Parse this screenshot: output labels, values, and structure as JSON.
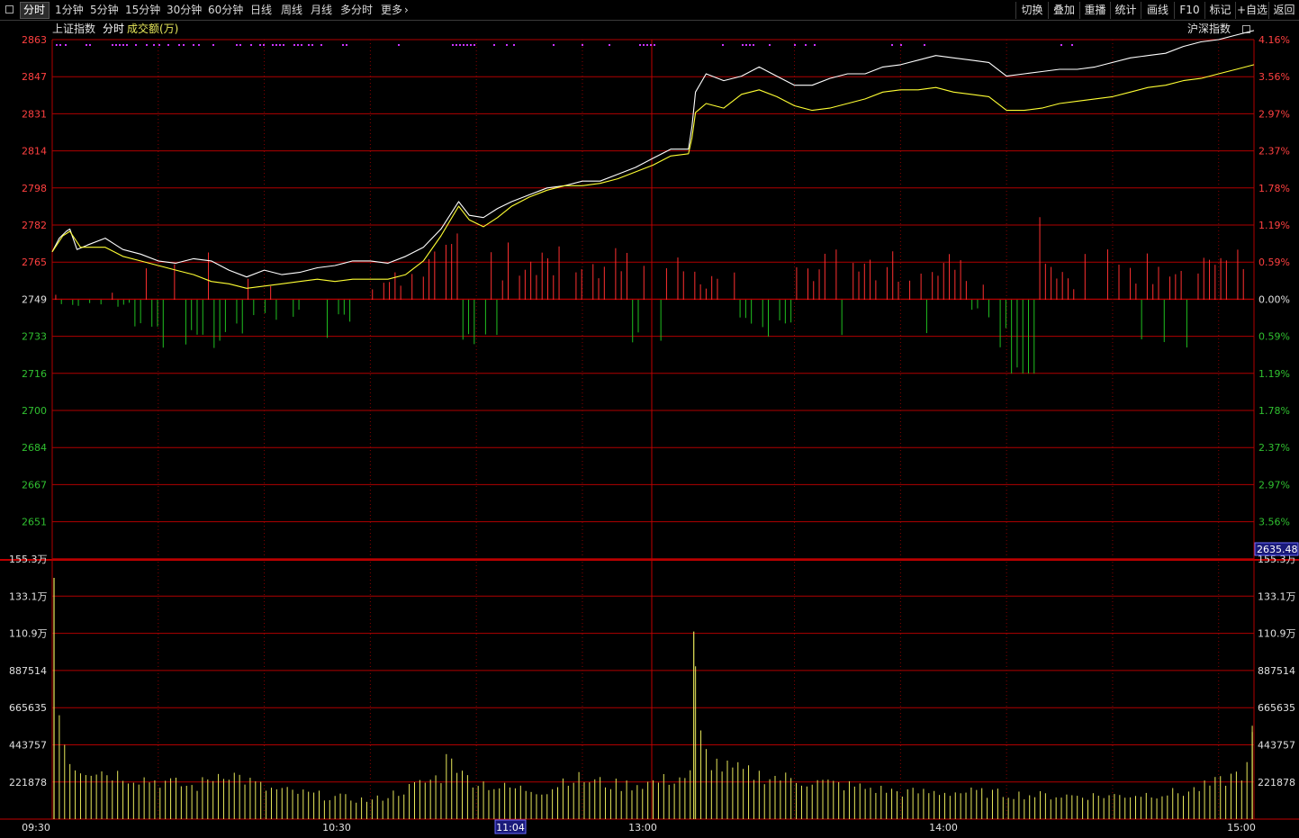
{
  "toolbar": {
    "periods": [
      "分时",
      "1分钟",
      "5分钟",
      "15分钟",
      "30分钟",
      "60分钟",
      "日线",
      "周线",
      "月线",
      "多分时",
      "更多"
    ],
    "active_period": "分时",
    "buttons": [
      "切换",
      "叠加",
      "重播",
      "统计",
      "画线",
      "F10",
      "标记",
      "+自选",
      "返回"
    ]
  },
  "header": {
    "index_name": "上证指数",
    "mode_label": "分时",
    "volume_label": "成交额(万)",
    "overlay_label": "沪深指数"
  },
  "colors": {
    "price_line": "#ffffff",
    "avg_line": "#ffff33",
    "grid": "#b00000",
    "up": "#ff3030",
    "down": "#20c020",
    "volume": "#e8e85a",
    "marker": "#cc33ff"
  },
  "cursor": {
    "time_label": "11:04",
    "value_label": "2635.48"
  },
  "chart_data": [
    {
      "type": "line",
      "title": "上证指数 分时",
      "ylim": [
        2635.48,
        2863
      ],
      "y_ticks_left": [
        "2863",
        "2847",
        "2831",
        "2814",
        "2798",
        "2782",
        "2765",
        "2749",
        "2733",
        "2716",
        "2700",
        "2684",
        "2667",
        "2651"
      ],
      "y_ticks_right": [
        "4.16%",
        "3.56%",
        "2.97%",
        "2.37%",
        "1.78%",
        "1.19%",
        "0.59%",
        "0.00%",
        "0.59%",
        "1.19%",
        "1.78%",
        "2.37%",
        "2.97%",
        "3.56%"
      ],
      "baseline": 2749,
      "x_ticks": [
        "09:30",
        "10:30",
        "13:00",
        "14:00",
        "15:00"
      ],
      "series": [
        {
          "role": "price",
          "points": [
            [
              0,
              2770
            ],
            [
              2,
              2776
            ],
            [
              4,
              2779
            ],
            [
              5,
              2780
            ],
            [
              7,
              2771
            ],
            [
              10,
              2773
            ],
            [
              15,
              2776
            ],
            [
              20,
              2771
            ],
            [
              25,
              2769
            ],
            [
              30,
              2766
            ],
            [
              35,
              2765
            ],
            [
              40,
              2767
            ],
            [
              45,
              2766
            ],
            [
              50,
              2762
            ],
            [
              55,
              2759
            ],
            [
              60,
              2762
            ],
            [
              65,
              2760
            ],
            [
              70,
              2761
            ],
            [
              75,
              2763
            ],
            [
              80,
              2764
            ],
            [
              85,
              2766
            ],
            [
              90,
              2766
            ],
            [
              95,
              2765
            ],
            [
              100,
              2768
            ],
            [
              105,
              2772
            ],
            [
              110,
              2780
            ],
            [
              115,
              2792
            ],
            [
              118,
              2786
            ],
            [
              122,
              2785
            ],
            [
              126,
              2789
            ],
            [
              130,
              2792
            ],
            [
              135,
              2795
            ],
            [
              140,
              2798
            ],
            [
              145,
              2799
            ],
            [
              150,
              2801
            ],
            [
              155,
              2801
            ],
            [
              160,
              2804
            ],
            [
              165,
              2807
            ],
            [
              170,
              2811
            ],
            [
              175,
              2815
            ],
            [
              180,
              2815
            ],
            [
              181,
              2825
            ],
            [
              182,
              2840
            ],
            [
              185,
              2848
            ],
            [
              190,
              2845
            ],
            [
              195,
              2847
            ],
            [
              200,
              2851
            ],
            [
              205,
              2847
            ],
            [
              210,
              2843
            ],
            [
              215,
              2843
            ],
            [
              220,
              2846
            ],
            [
              225,
              2848
            ],
            [
              230,
              2848
            ],
            [
              235,
              2851
            ],
            [
              240,
              2852
            ],
            [
              245,
              2854
            ],
            [
              250,
              2856
            ],
            [
              255,
              2855
            ],
            [
              260,
              2854
            ],
            [
              265,
              2853
            ],
            [
              270,
              2847
            ],
            [
              275,
              2848
            ],
            [
              280,
              2849
            ],
            [
              285,
              2850
            ],
            [
              290,
              2850
            ],
            [
              295,
              2851
            ],
            [
              300,
              2853
            ],
            [
              305,
              2855
            ],
            [
              310,
              2856
            ],
            [
              315,
              2857
            ],
            [
              320,
              2860
            ],
            [
              325,
              2862
            ],
            [
              330,
              2863
            ],
            [
              335,
              2865
            ],
            [
              340,
              2867
            ]
          ]
        },
        {
          "role": "average",
          "points": [
            [
              0,
              2770
            ],
            [
              3,
              2777
            ],
            [
              5,
              2779
            ],
            [
              8,
              2772
            ],
            [
              15,
              2772
            ],
            [
              20,
              2768
            ],
            [
              25,
              2766
            ],
            [
              30,
              2764
            ],
            [
              35,
              2762
            ],
            [
              40,
              2760
            ],
            [
              45,
              2757
            ],
            [
              50,
              2756
            ],
            [
              55,
              2754
            ],
            [
              60,
              2755
            ],
            [
              65,
              2756
            ],
            [
              70,
              2757
            ],
            [
              75,
              2758
            ],
            [
              80,
              2757
            ],
            [
              85,
              2758
            ],
            [
              90,
              2758
            ],
            [
              95,
              2758
            ],
            [
              100,
              2760
            ],
            [
              105,
              2766
            ],
            [
              110,
              2777
            ],
            [
              115,
              2790
            ],
            [
              118,
              2784
            ],
            [
              122,
              2781
            ],
            [
              126,
              2785
            ],
            [
              130,
              2790
            ],
            [
              135,
              2794
            ],
            [
              140,
              2797
            ],
            [
              145,
              2799
            ],
            [
              150,
              2799
            ],
            [
              155,
              2800
            ],
            [
              160,
              2802
            ],
            [
              165,
              2805
            ],
            [
              170,
              2808
            ],
            [
              175,
              2812
            ],
            [
              180,
              2813
            ],
            [
              181,
              2820
            ],
            [
              182,
              2831
            ],
            [
              185,
              2835
            ],
            [
              190,
              2833
            ],
            [
              195,
              2839
            ],
            [
              200,
              2841
            ],
            [
              205,
              2838
            ],
            [
              210,
              2834
            ],
            [
              215,
              2832
            ],
            [
              220,
              2833
            ],
            [
              225,
              2835
            ],
            [
              230,
              2837
            ],
            [
              235,
              2840
            ],
            [
              240,
              2841
            ],
            [
              245,
              2841
            ],
            [
              250,
              2842
            ],
            [
              255,
              2840
            ],
            [
              260,
              2839
            ],
            [
              265,
              2838
            ],
            [
              270,
              2832
            ],
            [
              275,
              2832
            ],
            [
              280,
              2833
            ],
            [
              285,
              2835
            ],
            [
              290,
              2836
            ],
            [
              295,
              2837
            ],
            [
              300,
              2838
            ],
            [
              305,
              2840
            ],
            [
              310,
              2842
            ],
            [
              315,
              2843
            ],
            [
              320,
              2845
            ],
            [
              325,
              2846
            ],
            [
              330,
              2848
            ],
            [
              335,
              2850
            ],
            [
              340,
              2852
            ]
          ]
        }
      ]
    },
    {
      "type": "bar",
      "title": "成交额(万)",
      "ylim": [
        0,
        1553000
      ],
      "y_ticks": [
        "155.3万",
        "133.1万",
        "110.9万",
        "887514",
        "665635",
        "443757",
        "221878"
      ],
      "peaks": [
        [
          0,
          1440000
        ],
        [
          1,
          670000
        ],
        [
          2,
          570000
        ],
        [
          3,
          470000
        ],
        [
          5,
          330000
        ],
        [
          10,
          300000
        ],
        [
          20,
          260000
        ],
        [
          40,
          190000
        ],
        [
          48,
          290000
        ],
        [
          60,
          180000
        ],
        [
          80,
          130000
        ],
        [
          90,
          110000
        ],
        [
          100,
          180000
        ],
        [
          110,
          260000
        ],
        [
          112,
          450000
        ],
        [
          115,
          260000
        ],
        [
          125,
          190000
        ],
        [
          140,
          170000
        ],
        [
          145,
          250000
        ],
        [
          160,
          200000
        ],
        [
          170,
          220000
        ],
        [
          180,
          260000
        ],
        [
          181,
          1120000
        ],
        [
          182,
          530000
        ],
        [
          185,
          360000
        ],
        [
          190,
          300000
        ],
        [
          200,
          260000
        ],
        [
          220,
          210000
        ],
        [
          240,
          160000
        ],
        [
          260,
          160000
        ],
        [
          280,
          140000
        ],
        [
          300,
          140000
        ],
        [
          320,
          160000
        ],
        [
          330,
          220000
        ],
        [
          338,
          300000
        ],
        [
          339,
          520000
        ]
      ]
    }
  ]
}
